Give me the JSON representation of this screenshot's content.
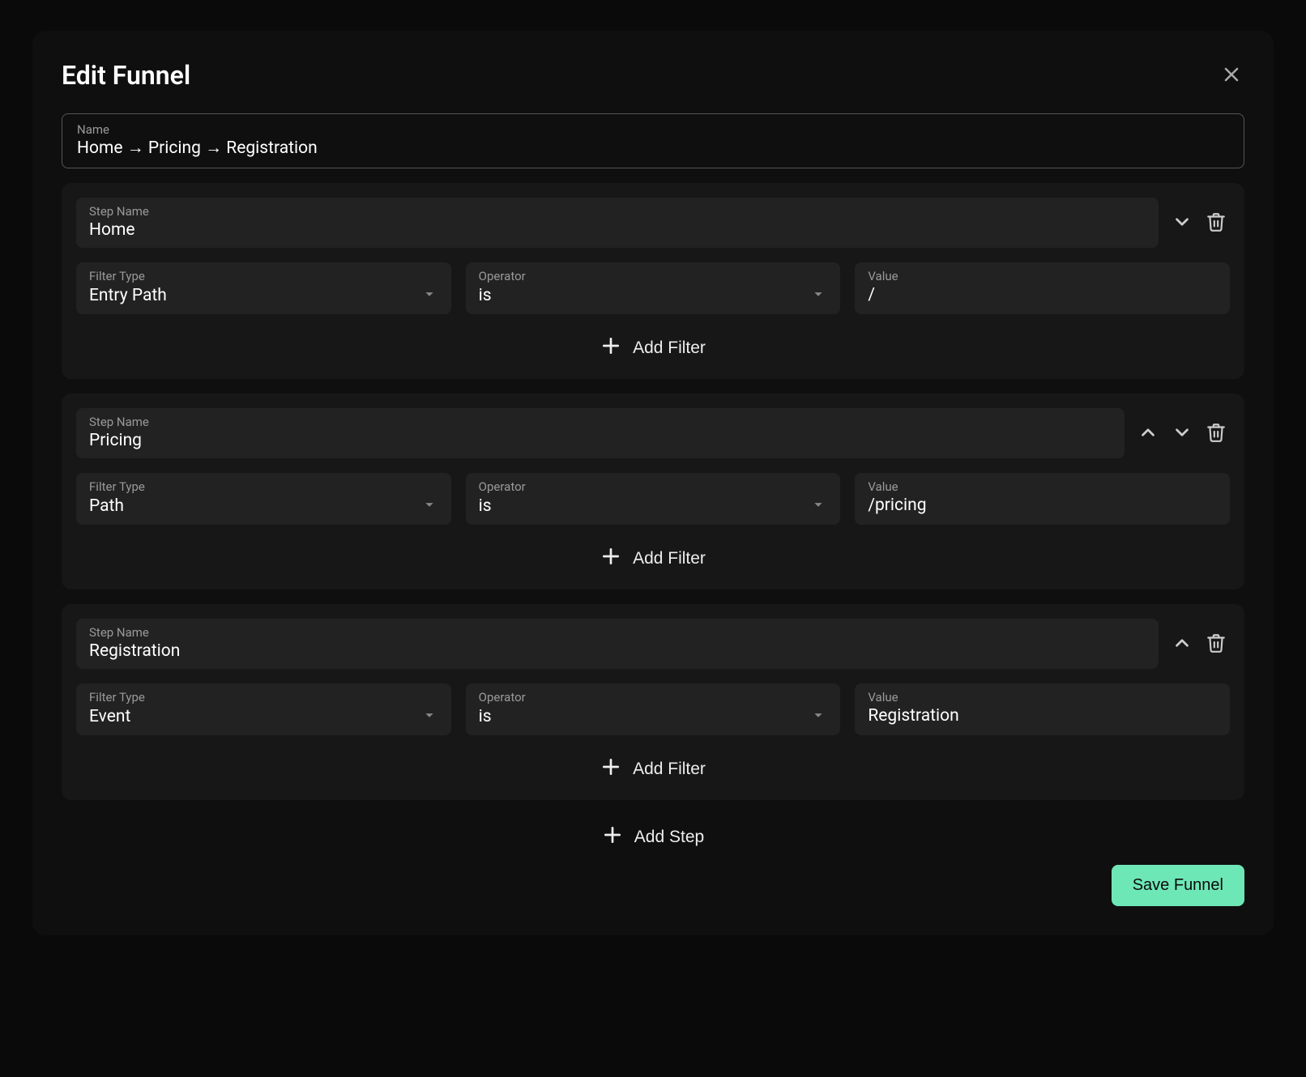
{
  "modal": {
    "title": "Edit Funnel",
    "nameLabel": "Name",
    "nameValue": "Home → Pricing → Registration",
    "addFilterLabel": "Add Filter",
    "addStepLabel": "Add Step",
    "saveLabel": "Save Funnel",
    "labels": {
      "stepName": "Step Name",
      "filterType": "Filter Type",
      "operator": "Operator",
      "value": "Value"
    }
  },
  "steps": [
    {
      "name": "Home",
      "showUp": false,
      "showDown": true,
      "filter": {
        "type": "Entry Path",
        "operator": "is",
        "value": "/"
      }
    },
    {
      "name": "Pricing",
      "showUp": true,
      "showDown": true,
      "filter": {
        "type": "Path",
        "operator": "is",
        "value": "/pricing"
      }
    },
    {
      "name": "Registration",
      "showUp": true,
      "showDown": false,
      "filter": {
        "type": "Event",
        "operator": "is",
        "value": "Registration"
      }
    }
  ]
}
